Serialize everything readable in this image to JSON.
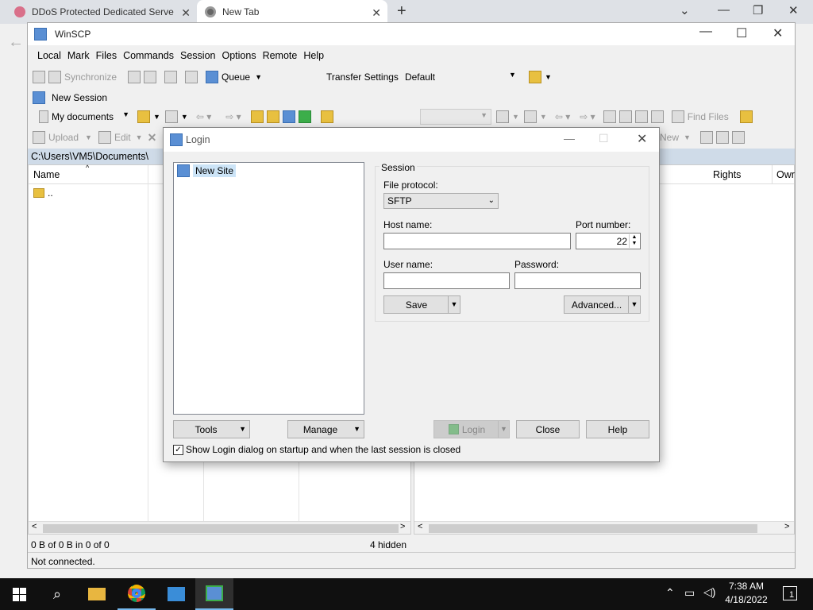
{
  "browser": {
    "tabs": [
      {
        "title": "DDoS Protected Dedicated Serve",
        "close": "✕"
      },
      {
        "title": "New Tab",
        "close": "✕"
      }
    ],
    "new_tab": "+"
  },
  "winscp": {
    "title": "WinSCP",
    "menu": [
      "Local",
      "Mark",
      "Files",
      "Commands",
      "Session",
      "Options",
      "Remote",
      "Help"
    ],
    "toolbar": {
      "synchronize": "Synchronize",
      "queue": "Queue",
      "transfer_settings": "Transfer Settings",
      "transfer_value": "Default",
      "new_session": "New Session"
    },
    "local": {
      "location": "My documents",
      "upload": "Upload",
      "edit": "Edit",
      "path": "C:\\Users\\VM5\\Documents\\",
      "col_name": "Name",
      "parent_dir": "..",
      "status_left": "0 B of 0 B in 0 of 0",
      "status_hidden": "4 hidden"
    },
    "remote": {
      "find_files": "Find Files",
      "new": "New",
      "col_rights": "Rights",
      "col_owner": "Owr"
    },
    "status_bar": "Not connected."
  },
  "login": {
    "title": "Login",
    "sites": [
      "New Site"
    ],
    "session_group": "Session",
    "file_protocol_label": "File protocol:",
    "file_protocol_value": "SFTP",
    "host_label": "Host name:",
    "host_value": "",
    "port_label": "Port number:",
    "port_value": "22",
    "user_label": "User name:",
    "user_value": "",
    "password_label": "Password:",
    "password_value": "",
    "save": "Save",
    "advanced": "Advanced...",
    "tools": "Tools",
    "manage": "Manage",
    "login": "Login",
    "close": "Close",
    "help": "Help",
    "show_on_startup": "Show Login dialog on startup and when the last session is closed",
    "show_on_startup_checked": true
  },
  "taskbar": {
    "time": "7:38 AM",
    "date": "4/18/2022",
    "notifications": "1"
  }
}
